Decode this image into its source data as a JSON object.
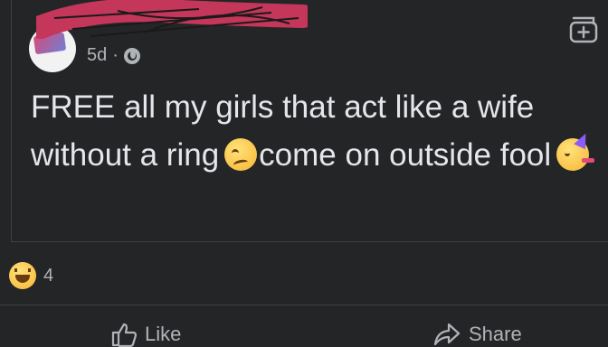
{
  "post": {
    "time": "5d",
    "separator": "·",
    "privacy_icon": "globe-icon",
    "text_1": "FREE all my girls that act like a wife without a ring",
    "emoji_1": "woozy-face-emoji",
    "text_2": "come on outside fool",
    "emoji_2": "partying-face-emoji"
  },
  "header": {
    "save_icon": "save-post-icon"
  },
  "reactions": {
    "icon": "haha-reaction-icon",
    "count": "4"
  },
  "actions": {
    "like_label": "Like",
    "share_label": "Share"
  },
  "colors": {
    "background": "#242526",
    "text": "#e4e6eb",
    "secondary": "#b0b3b8",
    "redaction": "#c4365a"
  }
}
